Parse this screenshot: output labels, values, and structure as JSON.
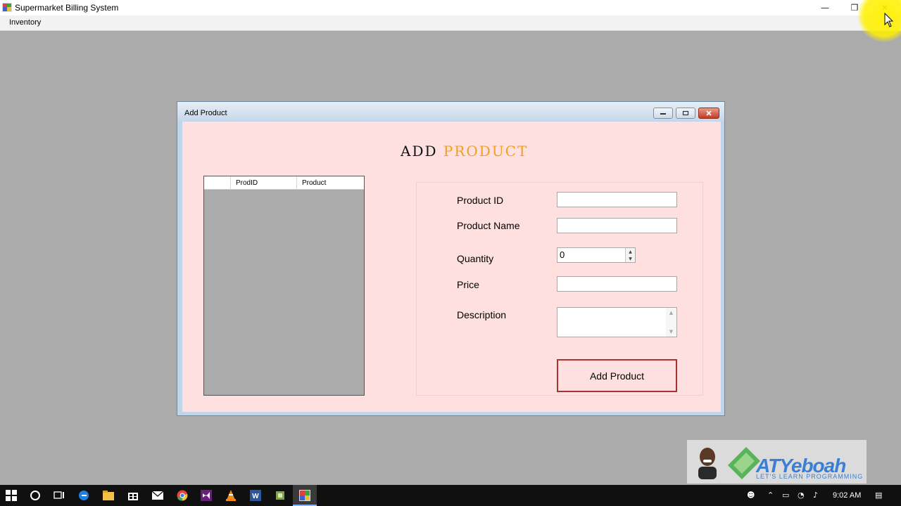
{
  "main_window": {
    "title": "Supermarket Billing System",
    "controls": {
      "minimize": "—",
      "restore": "❐",
      "close": "✕"
    },
    "menu": [
      "Inventory"
    ]
  },
  "add_product_form": {
    "title": "Add Product",
    "heading_part1": "ADD",
    "heading_part2": "PRODUCT",
    "heading_accent_color": "#f0a020",
    "grid": {
      "columns": [
        "",
        "ProdID",
        "Product"
      ],
      "rows": []
    },
    "fields": {
      "product_id": {
        "label": "Product ID",
        "value": ""
      },
      "product_name": {
        "label": "Product Name",
        "value": ""
      },
      "quantity": {
        "label": "Quantity",
        "value": "0"
      },
      "price": {
        "label": "Price",
        "value": ""
      },
      "description": {
        "label": "Description",
        "value": ""
      }
    },
    "add_button": "Add Product"
  },
  "watermark": {
    "name": "ATYeboah",
    "tagline": "LET'S LEARN PROGRAMMING"
  },
  "taskbar": {
    "icons": [
      "windows-start-icon",
      "cortana-icon",
      "task-view-icon",
      "edge-icon",
      "file-explorer-icon",
      "store-icon",
      "mail-icon",
      "chrome-icon",
      "visual-studio-icon",
      "vlc-icon",
      "word-icon",
      "app-icon",
      "supermarket-app-icon"
    ],
    "clock": "9:02 AM"
  },
  "colors": {
    "form_background": "#ffe0e0",
    "desktop": "#ababab",
    "button_border": "#a83232",
    "watermark_blue": "#3a7fd6"
  }
}
